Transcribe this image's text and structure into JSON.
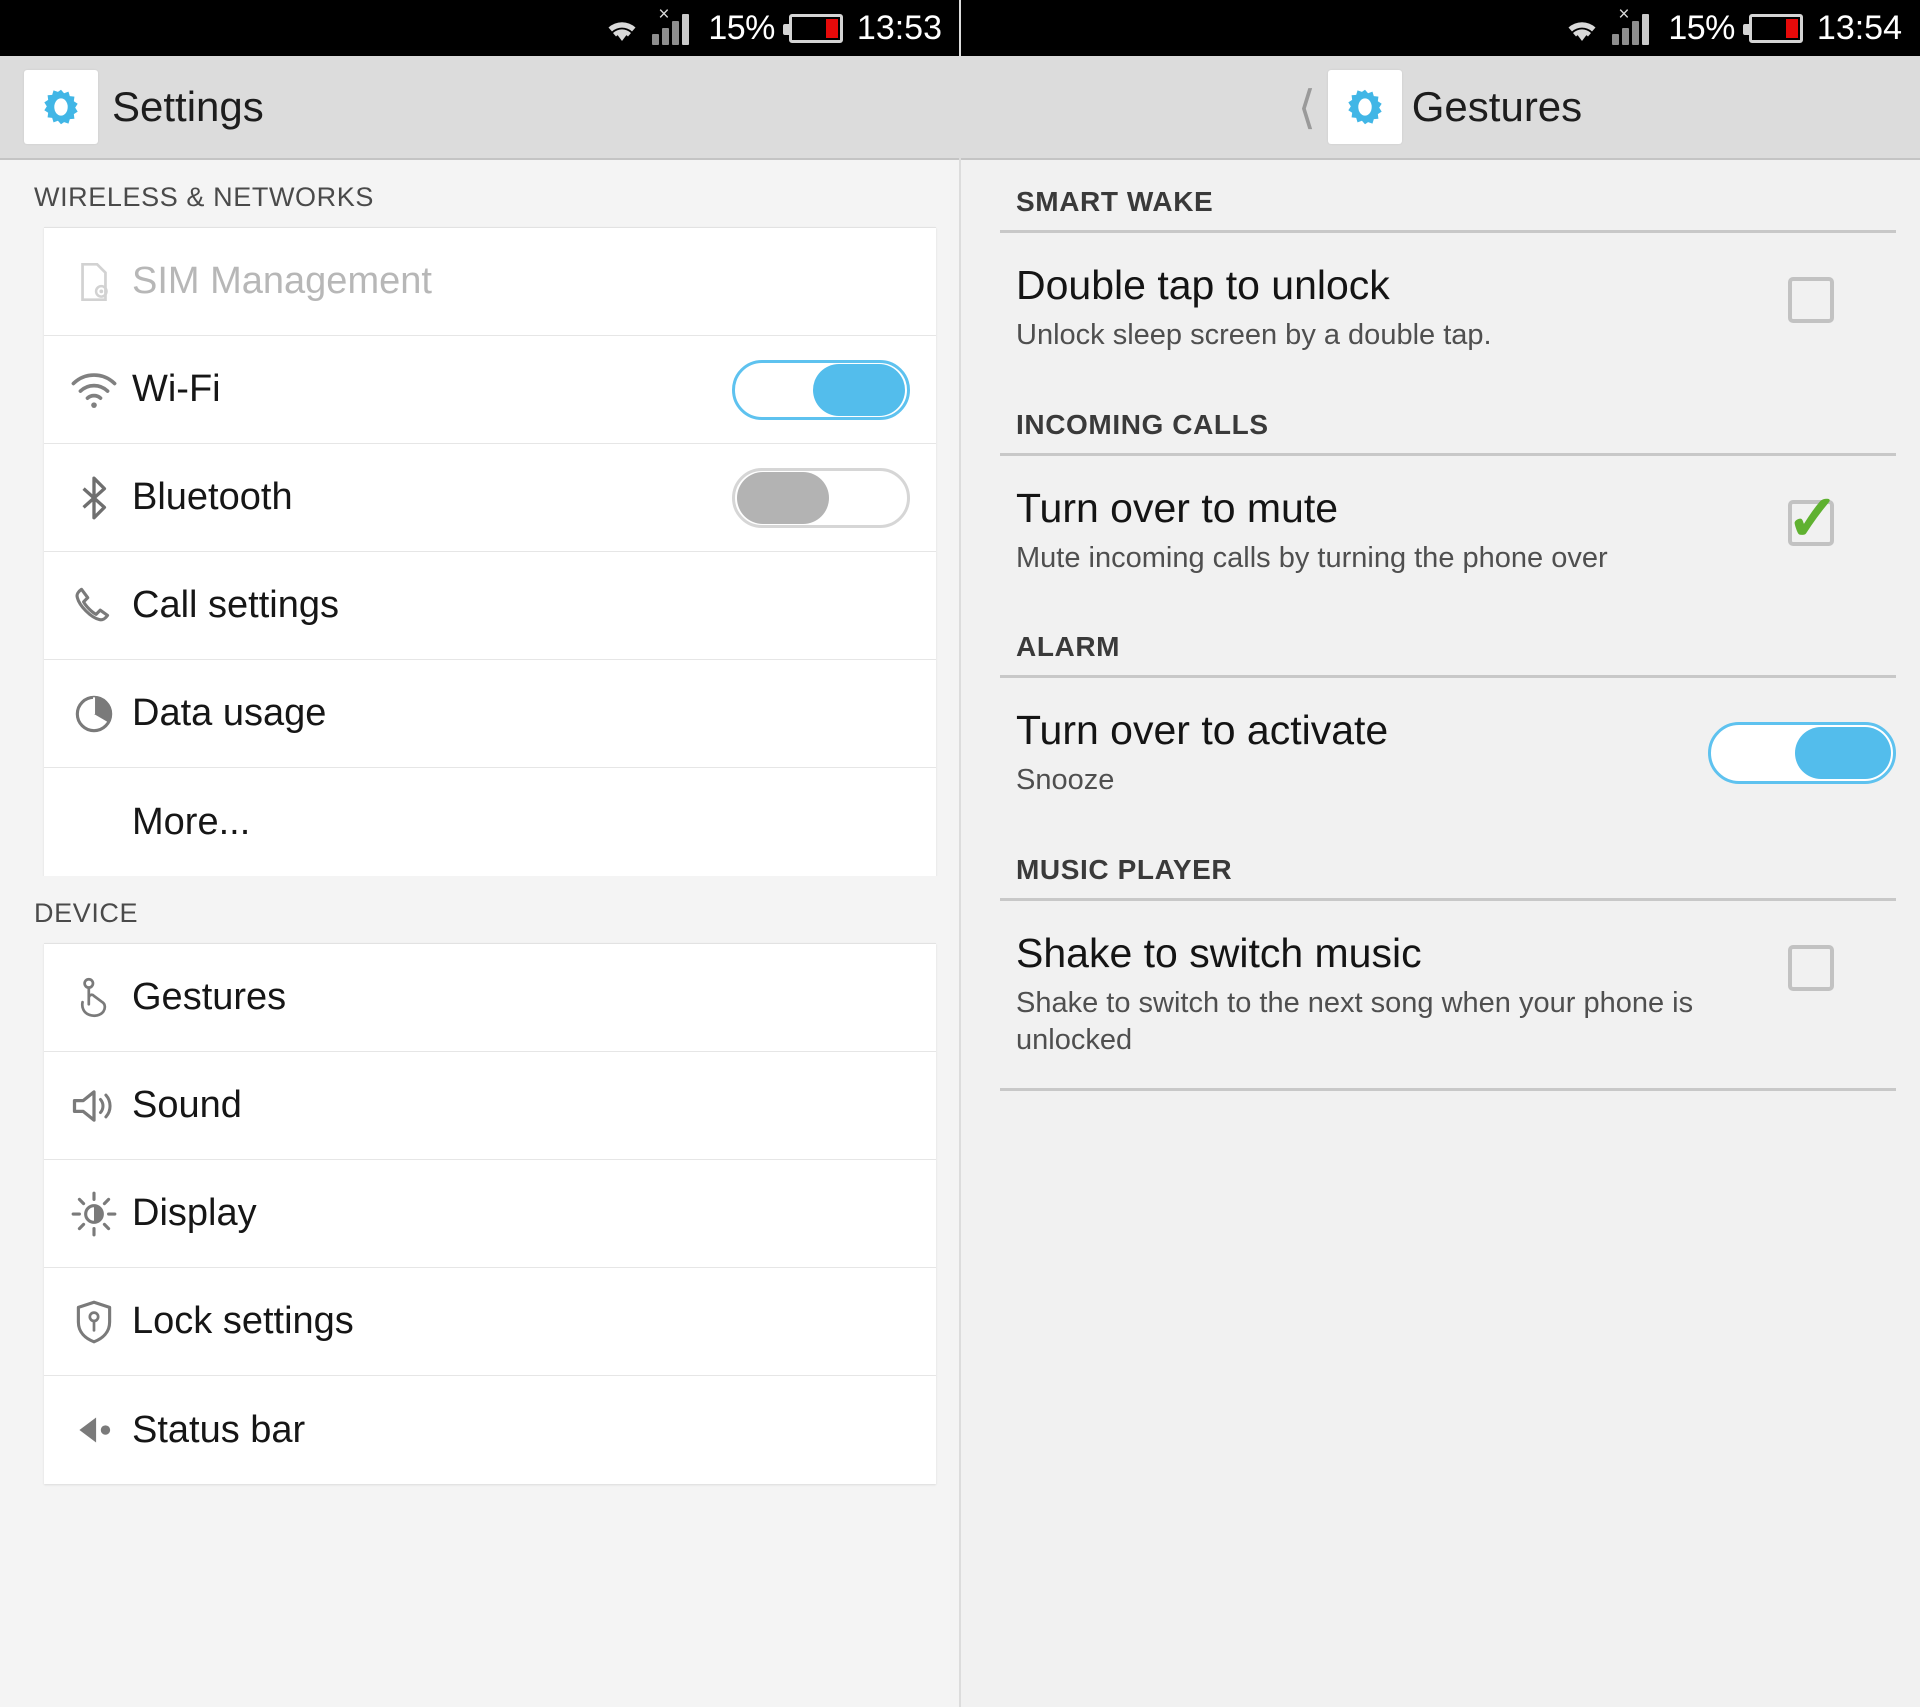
{
  "left": {
    "statusbar": {
      "battery_percent": "15%",
      "time": "13:53",
      "wifi_icon": "wifi-icon",
      "signal_icon": "signal-bars-icon",
      "signal_x": "×",
      "battery_icon": "battery-low-icon"
    },
    "actionbar": {
      "title": "Settings",
      "app_icon": "gear-icon"
    },
    "sections": [
      {
        "header": "WIRELESS & NETWORKS",
        "rows": [
          {
            "label": "SIM Management",
            "icon": "sim-card-icon",
            "control": "none",
            "disabled": true
          },
          {
            "label": "Wi-Fi",
            "icon": "wifi-icon",
            "control": "toggle",
            "state": "on"
          },
          {
            "label": "Bluetooth",
            "icon": "bluetooth-icon",
            "control": "toggle",
            "state": "off"
          },
          {
            "label": "Call settings",
            "icon": "phone-handset-icon",
            "control": "none"
          },
          {
            "label": "Data usage",
            "icon": "data-usage-pie-icon",
            "control": "none"
          },
          {
            "label": "More...",
            "icon": "none",
            "control": "none"
          }
        ]
      },
      {
        "header": "DEVICE",
        "rows": [
          {
            "label": "Gestures",
            "icon": "hand-tap-icon",
            "control": "none"
          },
          {
            "label": "Sound",
            "icon": "speaker-icon",
            "control": "none"
          },
          {
            "label": "Display",
            "icon": "brightness-sun-icon",
            "control": "none"
          },
          {
            "label": "Lock settings",
            "icon": "shield-key-icon",
            "control": "none"
          },
          {
            "label": "Status bar",
            "icon": "status-bar-icon",
            "control": "none"
          }
        ]
      }
    ]
  },
  "right": {
    "statusbar": {
      "battery_percent": "15%",
      "time": "13:54",
      "wifi_icon": "wifi-icon",
      "signal_icon": "signal-bars-icon",
      "signal_x": "×",
      "battery_icon": "battery-low-icon"
    },
    "actionbar": {
      "title": "Gestures",
      "app_icon": "gear-icon",
      "back_icon": "back-chevron-icon"
    },
    "groups": [
      {
        "header": "SMART WAKE",
        "items": [
          {
            "title": "Double tap to unlock",
            "subtitle": "Unlock sleep screen by a double tap.",
            "control": "checkbox",
            "state": "unchecked"
          }
        ]
      },
      {
        "header": "INCOMING CALLS",
        "items": [
          {
            "title": "Turn over to mute",
            "subtitle": "Mute incoming calls by turning the phone over",
            "control": "checkbox",
            "state": "checked"
          }
        ]
      },
      {
        "header": "ALARM",
        "items": [
          {
            "title": "Turn over to activate",
            "subtitle": "Snooze",
            "control": "toggle",
            "state": "on"
          }
        ]
      },
      {
        "header": "MUSIC PLAYER",
        "items": [
          {
            "title": "Shake to switch music",
            "subtitle": "Shake to switch to the next song when your phone is unlocked",
            "control": "checkbox",
            "state": "unchecked"
          }
        ]
      }
    ]
  },
  "colors": {
    "accent_blue": "#53bdec",
    "check_green": "#5fb130",
    "battery_red": "#e60a0a",
    "actionbar_bg": "#dcdcdc"
  }
}
